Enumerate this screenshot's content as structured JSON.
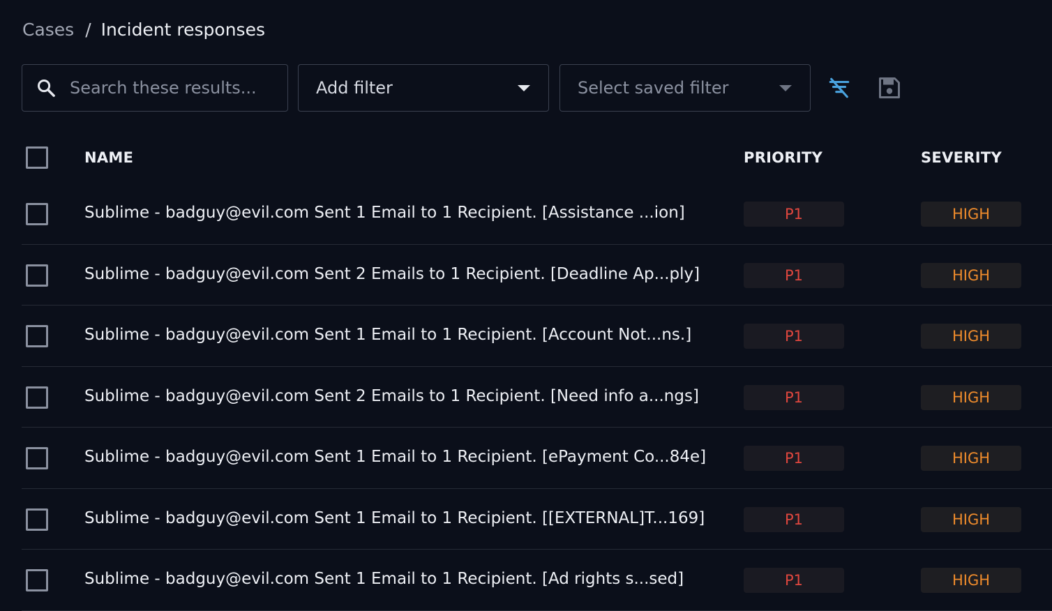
{
  "breadcrumb": {
    "root": "Cases",
    "separator": "/",
    "current": "Incident responses"
  },
  "toolbar": {
    "search_placeholder": "Search these results...",
    "add_filter_label": "Add filter",
    "saved_filter_placeholder": "Select saved filter",
    "clear_filter_icon": "filter-off-icon",
    "save_filter_icon": "floppy-disk-icon"
  },
  "table": {
    "columns": {
      "name": "NAME",
      "priority": "PRIORITY",
      "severity": "SEVERITY"
    },
    "rows": [
      {
        "name": "Sublime - badguy@evil.com Sent 1 Email to 1 Recipient. [Assistance ...ion]",
        "priority": "P1",
        "severity": "HIGH"
      },
      {
        "name": "Sublime - badguy@evil.com Sent 2 Emails to 1 Recipient. [Deadline Ap...ply]",
        "priority": "P1",
        "severity": "HIGH"
      },
      {
        "name": "Sublime - badguy@evil.com Sent 1 Email to 1 Recipient. [Account Not...ns.]",
        "priority": "P1",
        "severity": "HIGH"
      },
      {
        "name": "Sublime - badguy@evil.com Sent 2 Emails to 1 Recipient. [Need info a...ngs]",
        "priority": "P1",
        "severity": "HIGH"
      },
      {
        "name": "Sublime - badguy@evil.com Sent 1 Email to 1 Recipient. [ePayment Co...84e]",
        "priority": "P1",
        "severity": "HIGH"
      },
      {
        "name": "Sublime - badguy@evil.com Sent 1 Email to 1 Recipient. [[EXTERNAL]T...169]",
        "priority": "P1",
        "severity": "HIGH"
      },
      {
        "name": "Sublime - badguy@evil.com Sent 1 Email to 1 Recipient. [Ad rights s...sed]",
        "priority": "P1",
        "severity": "HIGH"
      }
    ]
  },
  "colors": {
    "background": "#0b0f1a",
    "priority_text": "#e0473f",
    "severity_text": "#f08c2c",
    "accent": "#4aa3df"
  }
}
